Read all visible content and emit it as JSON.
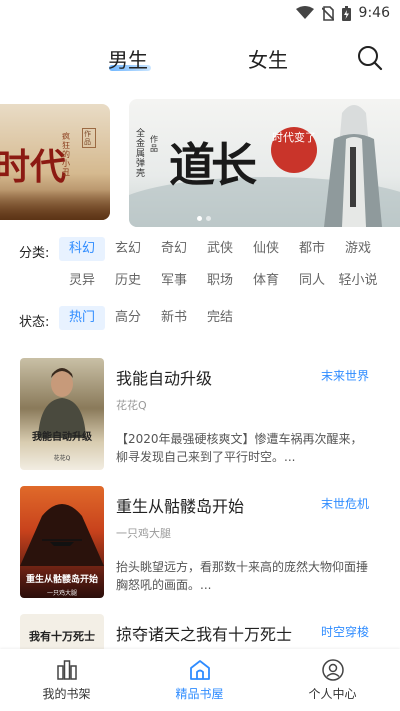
{
  "status": {
    "time": "9:46"
  },
  "tabs": {
    "male": "男生",
    "female": "女生"
  },
  "banner": {
    "left_title": "时代",
    "left_side_a": "疯狂的小丑",
    "left_side_b": "作品",
    "main_sub1": "全金属弹壳",
    "main_sub2": "作品",
    "main_title": "道长",
    "main_seal": "时代变了"
  },
  "filters": {
    "category_label": "分类:",
    "categories": [
      "科幻",
      "玄幻",
      "奇幻",
      "武侠",
      "仙侠",
      "都市",
      "游戏",
      "灵异",
      "历史",
      "军事",
      "职场",
      "体育",
      "同人",
      "轻小说"
    ],
    "status_label": "状态:",
    "statuses": [
      "热门",
      "高分",
      "新书",
      "完结"
    ]
  },
  "books": [
    {
      "title": "我能自动升级",
      "tag": "末来世界",
      "author": "花花Q",
      "desc": "【2020年最强硬核爽文】惨遭车祸再次醒来，柳寻发现自己来到了平行时空。...",
      "cover_title": "我能自动升级",
      "cover_author": "花花Q"
    },
    {
      "title": "重生从骷髅岛开始",
      "tag": "末世危机",
      "author": "一只鸡大腿",
      "desc": "抬头眺望远方，看那数十来高的庞然大物仰面捶胸怒吼的画面。...",
      "cover_title": "重生从骷髅岛开始",
      "cover_author": "一只鸡大腿"
    },
    {
      "title": "掠夺诸天之我有十万死士",
      "tag": "时空穿梭",
      "cover_title": "我有十万死士"
    }
  ],
  "nav": {
    "shelf": "我的书架",
    "store": "精品书屋",
    "me": "个人中心"
  },
  "colors": {
    "accent": "#2f8cff",
    "chip_bg": "#e8f2ff"
  }
}
